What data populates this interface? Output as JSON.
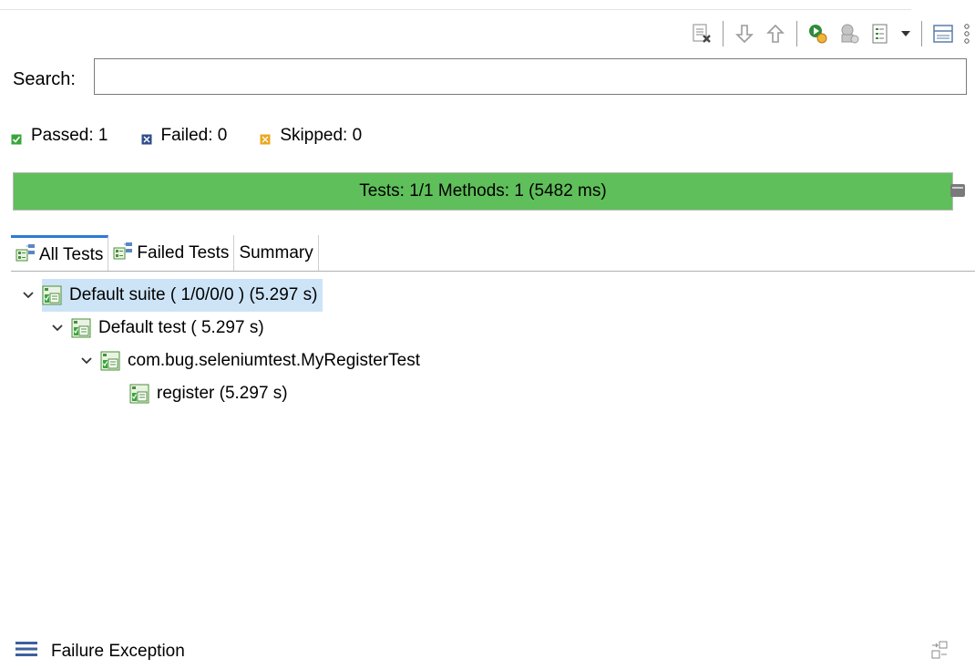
{
  "toolbar": {
    "buttons": [
      {
        "icon": "clear-results-icon"
      },
      {
        "icon": "next-failure-icon"
      },
      {
        "icon": "previous-failure-icon"
      },
      {
        "icon": "rerun-test-icon"
      },
      {
        "icon": "rerun-failed-icon"
      },
      {
        "icon": "history-icon"
      },
      {
        "icon": "dropdown-icon"
      },
      {
        "icon": "layout-icon"
      },
      {
        "icon": "view-menu-icon"
      }
    ]
  },
  "search": {
    "label": "Search:",
    "value": "",
    "placeholder": ""
  },
  "counters": {
    "passed": "Passed: 1",
    "failed": "Failed: 0",
    "skipped": "Skipped: 0"
  },
  "progress": {
    "text": "Tests: 1/1  Methods: 1 (5482 ms)",
    "fraction": 1.0,
    "color": "#5fbf5a"
  },
  "tabs": [
    {
      "label": "All Tests",
      "active": true
    },
    {
      "label": "Failed Tests",
      "active": false
    },
    {
      "label": "Summary",
      "active": false
    }
  ],
  "tree": [
    {
      "label": "Default suite ( 1/0/0/0 ) (5.297 s)",
      "selected": true,
      "expanded": true
    },
    {
      "label": "Default test ( 5.297 s)",
      "selected": false,
      "expanded": true
    },
    {
      "label": "com.bug.seleniumtest.MyRegisterTest",
      "selected": false,
      "expanded": true
    },
    {
      "label": "register  (5.297 s)",
      "selected": false,
      "expanded": false
    }
  ],
  "failure_section": {
    "label": "Failure Exception"
  },
  "colors": {
    "passed": "#3aa53a",
    "failed": "#2f4d8a",
    "skipped": "#e8a81e",
    "accent": "#2b7bd2",
    "selection": "#cde4f7"
  }
}
